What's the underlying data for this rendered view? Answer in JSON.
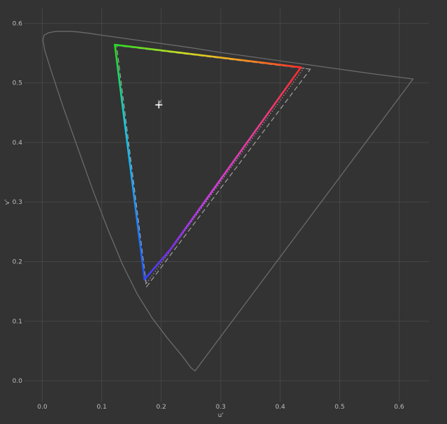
{
  "chart_data": {
    "type": "line",
    "title": "",
    "xlabel": "u'",
    "ylabel": "v'",
    "xlim": [
      -0.03,
      0.65
    ],
    "ylim": [
      -0.035,
      0.625
    ],
    "x_ticks": [
      "0.0",
      "0.1",
      "0.2",
      "0.3",
      "0.4",
      "0.5",
      "0.6"
    ],
    "y_ticks": [
      "0.0",
      "0.1",
      "0.2",
      "0.3",
      "0.4",
      "0.5",
      "0.6"
    ],
    "grid": true,
    "legend": "none",
    "colors": {
      "background": "#333333",
      "grid": "#464646",
      "locus": "#6b6b6b",
      "reference": "#a8a8a8",
      "red": "#ff2d2d",
      "green": "#22dd22",
      "blue": "#2050ff",
      "magenta": "#e33ad8",
      "cyan": "#10d0f0",
      "yellow": "#f0d020",
      "orange": "#ff7a20",
      "violet": "#7a2cf0",
      "white_point": "#ffffff"
    },
    "series": [
      {
        "role": "spectral-locus",
        "x": [
          0.2568,
          0.25,
          0.235,
          0.21,
          0.185,
          0.16,
          0.135,
          0.11,
          0.085,
          0.06,
          0.035,
          0.015,
          0.004,
          0.001,
          0.003,
          0.01,
          0.02,
          0.03,
          0.045,
          0.06,
          0.08,
          0.1,
          0.15,
          0.2,
          0.25,
          0.3,
          0.35,
          0.4,
          0.45,
          0.5,
          0.55,
          0.6,
          0.6234,
          0.2568
        ],
        "y": [
          0.0165,
          0.022,
          0.042,
          0.072,
          0.105,
          0.145,
          0.195,
          0.255,
          0.32,
          0.39,
          0.46,
          0.52,
          0.555,
          0.572,
          0.58,
          0.584,
          0.586,
          0.5865,
          0.5865,
          0.5855,
          0.583,
          0.58,
          0.573,
          0.566,
          0.559,
          0.551,
          0.544,
          0.537,
          0.53,
          0.523,
          0.516,
          0.5095,
          0.5065,
          0.0165
        ]
      },
      {
        "role": "reference-gamut-dashed",
        "x": [
          0.4507,
          0.125,
          0.1754,
          0.4507
        ],
        "y": [
          0.5229,
          0.5625,
          0.1579,
          0.5229
        ]
      },
      {
        "role": "reference-gamut-dotted",
        "x": [
          0.44,
          0.122,
          0.174,
          0.44
        ],
        "y": [
          0.525,
          0.563,
          0.162,
          0.525
        ]
      },
      {
        "role": "measured-gamut",
        "x": [
          0.435,
          0.122,
          0.172,
          0.215,
          0.435
        ],
        "y": [
          0.526,
          0.564,
          0.17,
          0.22,
          0.526
        ]
      }
    ],
    "white_point": {
      "x": 0.1978,
      "y": 0.4683
    },
    "white_point_measured": {
      "x": 0.196,
      "y": 0.463
    }
  }
}
